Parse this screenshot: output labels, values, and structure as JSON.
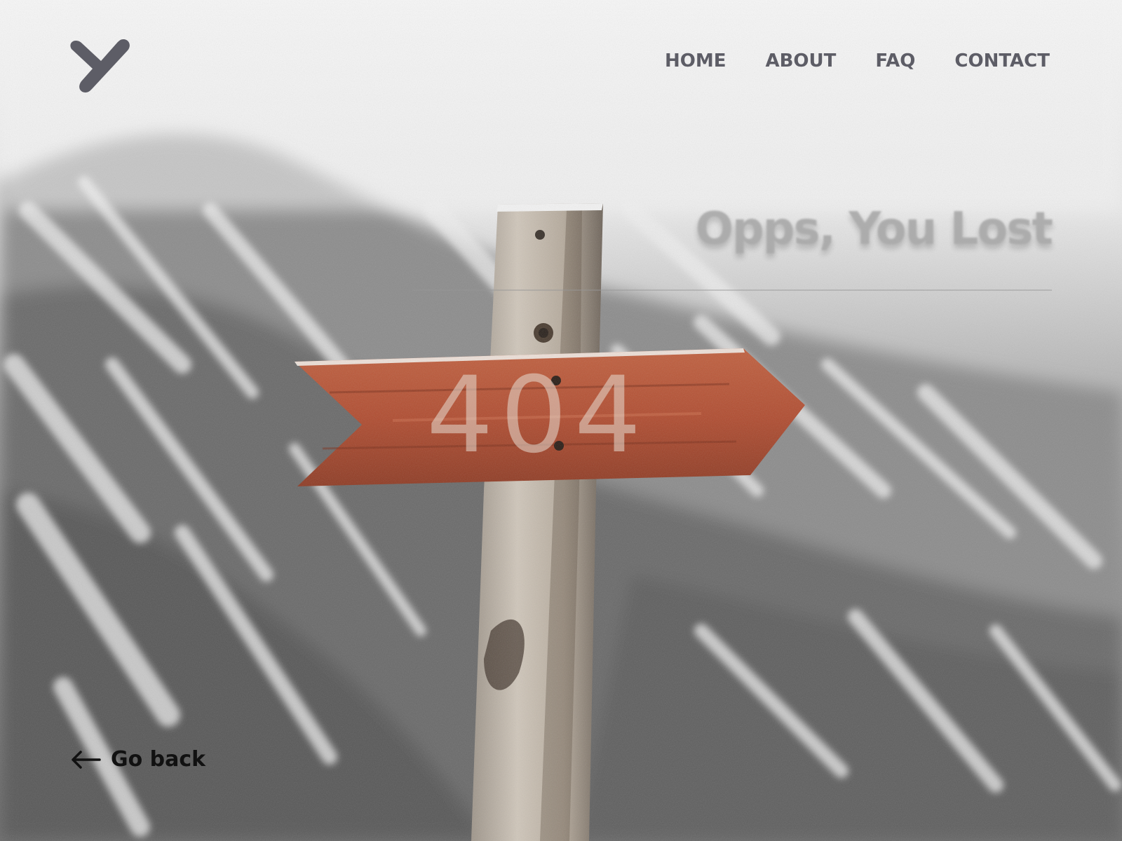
{
  "brand": {
    "logo_icon": "y-logo-icon"
  },
  "nav": {
    "items": [
      {
        "label": "HOME"
      },
      {
        "label": "ABOUT"
      },
      {
        "label": "FAQ"
      },
      {
        "label": "CONTACT"
      }
    ]
  },
  "error": {
    "headline": "Opps, You Lost",
    "code": "404"
  },
  "actions": {
    "go_back_label": "Go back",
    "go_back_icon": "arrow-left-icon"
  },
  "colors": {
    "nav_text": "#5d5d66",
    "logo": "#5d5d66",
    "sign_wood": "#b5553a"
  }
}
